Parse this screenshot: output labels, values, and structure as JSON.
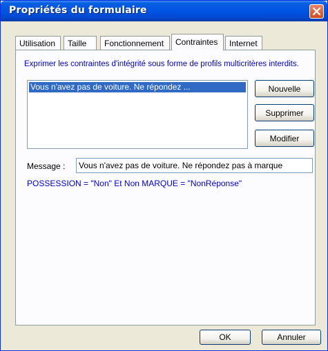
{
  "window": {
    "title": "Propriétés du formulaire"
  },
  "tabs": [
    {
      "label": "Utilisation"
    },
    {
      "label": "Taille"
    },
    {
      "label": "Fonctionnement"
    },
    {
      "label": "Contraintes"
    },
    {
      "label": "Internet"
    }
  ],
  "active_tab": "Contraintes",
  "panel": {
    "hint": "Exprimer les contraintes d'intégrité sous forme de profils multicritères interdits.",
    "list": {
      "items": [
        {
          "label": "Vous n'avez pas de voiture. Ne répondez ...",
          "selected": true
        }
      ]
    },
    "buttons": {
      "new": "Nouvelle",
      "delete": "Supprimer",
      "edit": "Modifier"
    },
    "message_label": "Message :",
    "message_value": "Vous n'avez pas de voiture. Ne répondez pas à marque",
    "expression": "POSSESSION = \"Non\" Et Non MARQUE = \"NonRéponse\""
  },
  "footer": {
    "ok": "OK",
    "cancel": "Annuler"
  }
}
